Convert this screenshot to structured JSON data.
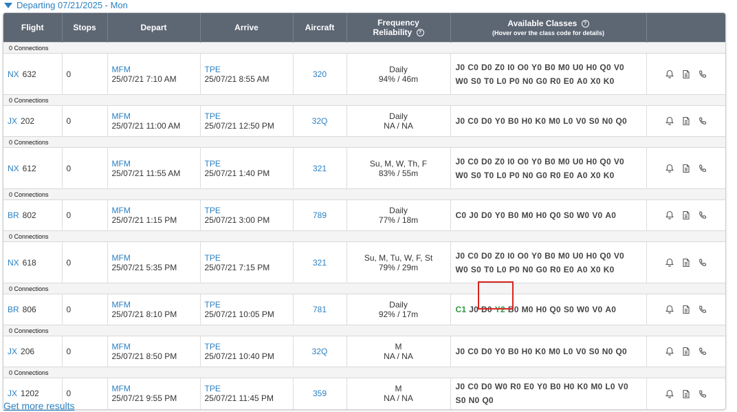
{
  "departing": {
    "label": "Departing 07/21/2025 - Mon"
  },
  "headers": {
    "flight": "Flight",
    "stops": "Stops",
    "depart": "Depart",
    "arrive": "Arrive",
    "aircraft": "Aircraft",
    "frequency_line1": "Frequency",
    "frequency_line2": "Reliability",
    "classes": "Available Classes",
    "classes_sub": "(Hover over the class code for details)"
  },
  "rows": [
    {
      "conn": "0 Connections",
      "airline": "NX",
      "num": "632",
      "stops": "0",
      "dep_code": "MFM",
      "dep_time": "25/07/21 7:10 AM",
      "arr_code": "TPE",
      "arr_time": "25/07/21 8:55 AM",
      "aircraft": "320",
      "freq": "Daily",
      "rel": "94% / 46m",
      "classes": [
        "J0",
        "C0",
        "D0",
        "Z0",
        "I0",
        "O0",
        "Y0",
        "B0",
        "M0",
        "U0",
        "H0",
        "Q0",
        "V0",
        "W0",
        "S0",
        "T0",
        "L0",
        "P0",
        "N0",
        "G0",
        "R0",
        "E0",
        "A0",
        "X0",
        "K0"
      ]
    },
    {
      "conn": "0 Connections",
      "airline": "JX",
      "num": "202",
      "stops": "0",
      "dep_code": "MFM",
      "dep_time": "25/07/21 11:00 AM",
      "arr_code": "TPE",
      "arr_time": "25/07/21 12:50 PM",
      "aircraft": "32Q",
      "freq": "Daily",
      "rel": "NA / NA",
      "classes": [
        "J0",
        "C0",
        "D0",
        "Y0",
        "B0",
        "H0",
        "K0",
        "M0",
        "L0",
        "V0",
        "S0",
        "N0",
        "Q0"
      ]
    },
    {
      "conn": "0 Connections",
      "airline": "NX",
      "num": "612",
      "stops": "0",
      "dep_code": "MFM",
      "dep_time": "25/07/21 11:55 AM",
      "arr_code": "TPE",
      "arr_time": "25/07/21 1:40 PM",
      "aircraft": "321",
      "freq": "Su, M, W, Th, F",
      "rel": "83% / 55m",
      "classes": [
        "J0",
        "C0",
        "D0",
        "Z0",
        "I0",
        "O0",
        "Y0",
        "B0",
        "M0",
        "U0",
        "H0",
        "Q0",
        "V0",
        "W0",
        "S0",
        "T0",
        "L0",
        "P0",
        "N0",
        "G0",
        "R0",
        "E0",
        "A0",
        "X0",
        "K0"
      ]
    },
    {
      "conn": "0 Connections",
      "airline": "BR",
      "num": "802",
      "stops": "0",
      "dep_code": "MFM",
      "dep_time": "25/07/21 1:15 PM",
      "arr_code": "TPE",
      "arr_time": "25/07/21 3:00 PM",
      "aircraft": "789",
      "freq": "Daily",
      "rel": "77% / 18m",
      "classes": [
        "C0",
        "J0",
        "D0",
        "Y0",
        "B0",
        "M0",
        "H0",
        "Q0",
        "S0",
        "W0",
        "V0",
        "A0"
      ]
    },
    {
      "conn": "0 Connections",
      "airline": "NX",
      "num": "618",
      "stops": "0",
      "dep_code": "MFM",
      "dep_time": "25/07/21 5:35 PM",
      "arr_code": "TPE",
      "arr_time": "25/07/21 7:15 PM",
      "aircraft": "321",
      "freq": "Su, M, Tu, W, F, St",
      "rel": "79% / 29m",
      "classes": [
        "J0",
        "C0",
        "D0",
        "Z0",
        "I0",
        "O0",
        "Y0",
        "B0",
        "M0",
        "U0",
        "H0",
        "Q0",
        "V0",
        "W0",
        "S0",
        "T0",
        "L0",
        "P0",
        "N0",
        "G0",
        "R0",
        "E0",
        "A0",
        "X0",
        "K0"
      ]
    },
    {
      "conn": "0 Connections",
      "airline": "BR",
      "num": "806",
      "stops": "0",
      "dep_code": "MFM",
      "dep_time": "25/07/21 8:10 PM",
      "arr_code": "TPE",
      "arr_time": "25/07/21 10:05 PM",
      "aircraft": "781",
      "freq": "Daily",
      "rel": "92% / 17m",
      "classes": [
        "C1",
        "J0",
        "D0",
        "Y2",
        "B0",
        "M0",
        "H0",
        "Q0",
        "S0",
        "W0",
        "V0",
        "A0"
      ]
    },
    {
      "conn": "0 Connections",
      "airline": "JX",
      "num": "206",
      "stops": "0",
      "dep_code": "MFM",
      "dep_time": "25/07/21 8:50 PM",
      "arr_code": "TPE",
      "arr_time": "25/07/21 10:40 PM",
      "aircraft": "32Q",
      "freq": "M",
      "rel": "NA / NA",
      "classes": [
        "J0",
        "C0",
        "D0",
        "Y0",
        "B0",
        "H0",
        "K0",
        "M0",
        "L0",
        "V0",
        "S0",
        "N0",
        "Q0"
      ]
    },
    {
      "conn": "0 Connections",
      "airline": "JX",
      "num": "1202",
      "stops": "0",
      "dep_code": "MFM",
      "dep_time": "25/07/21 9:55 PM",
      "arr_code": "TPE",
      "arr_time": "25/07/21 11:45 PM",
      "aircraft": "359",
      "freq": "M",
      "rel": "NA / NA",
      "classes": [
        "J0",
        "C0",
        "D0",
        "W0",
        "R0",
        "E0",
        "Y0",
        "B0",
        "H0",
        "K0",
        "M0",
        "L0",
        "V0",
        "S0",
        "N0",
        "Q0"
      ]
    }
  ],
  "row_heights": [
    60,
    45,
    60,
    45,
    60,
    45,
    45,
    45
  ],
  "more_link": "Get more results",
  "colors": {
    "header_bg": "#5d6673",
    "link": "#2a7fc1",
    "available": "#2e9a3e",
    "highlight": "#d9231f"
  },
  "icons": {
    "alert": "bell-icon",
    "details": "document-icon",
    "contact": "phone-icon"
  }
}
